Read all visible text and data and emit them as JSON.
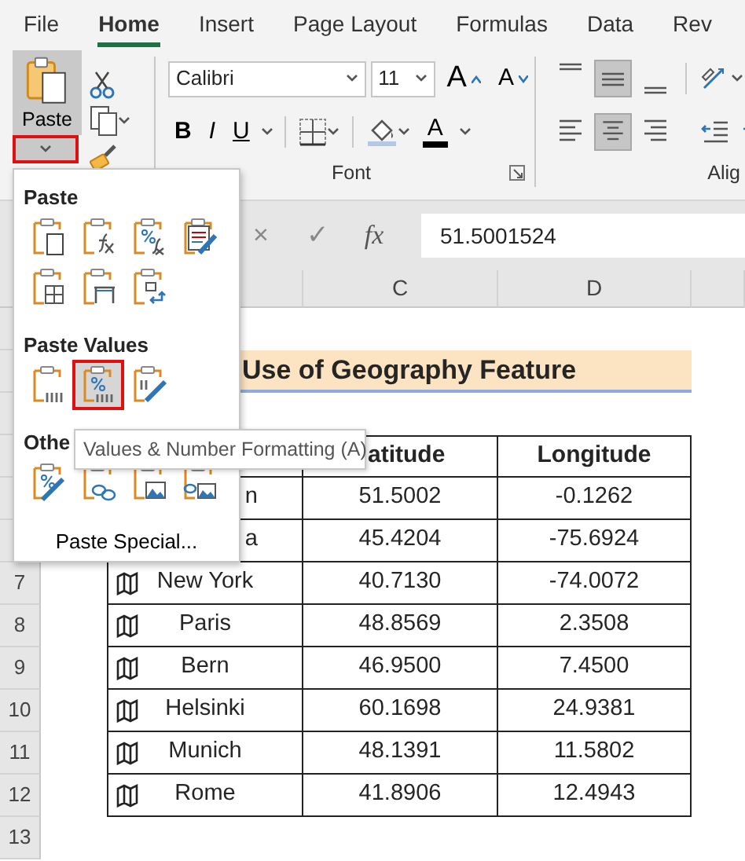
{
  "ribbon_tabs": [
    {
      "label": "File",
      "selected": false
    },
    {
      "label": "Home",
      "selected": true
    },
    {
      "label": "Insert",
      "selected": false
    },
    {
      "label": "Page Layout",
      "selected": false
    },
    {
      "label": "Formulas",
      "selected": false
    },
    {
      "label": "Data",
      "selected": false
    },
    {
      "label": "Rev",
      "selected": false
    }
  ],
  "clipboard": {
    "paste_label": "Paste",
    "dropdown_highlighted": true
  },
  "font": {
    "name": "Calibri",
    "size": "11",
    "grow": "A",
    "shrink": "A",
    "style_buttons": [
      "B",
      "I",
      "U"
    ],
    "font_color": "A",
    "group_label": "Font"
  },
  "alignment": {
    "vertical": [
      {
        "selected": false
      },
      {
        "selected": true
      },
      {
        "selected": false
      }
    ],
    "horizontal": [
      {
        "selected": false
      },
      {
        "selected": true
      },
      {
        "selected": false
      }
    ],
    "group_label": "Alig"
  },
  "formula_bar": {
    "cancel": "×",
    "enter": "✓",
    "function": "fx",
    "value": "51.5001524"
  },
  "paste_menu": {
    "sections": [
      {
        "title": "Paste",
        "items": [
          {
            "kind": "paste",
            "selected": false
          },
          {
            "kind": "formulas",
            "selected": false
          },
          {
            "kind": "formulas-number",
            "selected": false
          },
          {
            "kind": "keep-source",
            "selected": false
          },
          {
            "kind": "no-borders",
            "selected": false
          },
          {
            "kind": "column-widths",
            "selected": false
          },
          {
            "kind": "transpose",
            "selected": false
          }
        ]
      },
      {
        "title": "Paste Values",
        "items": [
          {
            "kind": "values",
            "selected": false
          },
          {
            "kind": "values-number",
            "selected": true
          },
          {
            "kind": "values-source",
            "selected": false
          }
        ]
      },
      {
        "title": "Othe",
        "items": [
          {
            "kind": "formatting",
            "selected": false
          },
          {
            "kind": "link",
            "selected": false
          },
          {
            "kind": "picture",
            "selected": false
          },
          {
            "kind": "linked-picture",
            "selected": false
          }
        ]
      }
    ],
    "footer": "Paste Special..."
  },
  "tooltip": "Values & Number Formatting (A)",
  "sheet": {
    "column_headers": [
      "C",
      "D"
    ],
    "row_numbers": [
      "7",
      "8",
      "9",
      "10",
      "11",
      "12",
      "13"
    ],
    "title": "Use of Geography Feature",
    "table": {
      "header": [
        "atitude",
        "Longitude"
      ],
      "rows": [
        {
          "city": "n",
          "latitude": "51.5002",
          "longitude": "-0.1262"
        },
        {
          "city": "a",
          "latitude": "45.4204",
          "longitude": "-75.6924"
        },
        {
          "map_icon": true,
          "city": "New York",
          "latitude": "40.7130",
          "longitude": "-74.0072"
        },
        {
          "map_icon": true,
          "city": "Paris",
          "latitude": "48.8569",
          "longitude": "2.3508"
        },
        {
          "map_icon": true,
          "city": "Bern",
          "latitude": "46.9500",
          "longitude": "7.4500"
        },
        {
          "map_icon": true,
          "city": "Helsinki",
          "latitude": "60.1698",
          "longitude": "24.9381"
        },
        {
          "map_icon": true,
          "city": "Munich",
          "latitude": "48.1391",
          "longitude": "11.5802"
        },
        {
          "map_icon": true,
          "city": "Rome",
          "latitude": "41.8906",
          "longitude": "12.4943"
        }
      ]
    }
  }
}
